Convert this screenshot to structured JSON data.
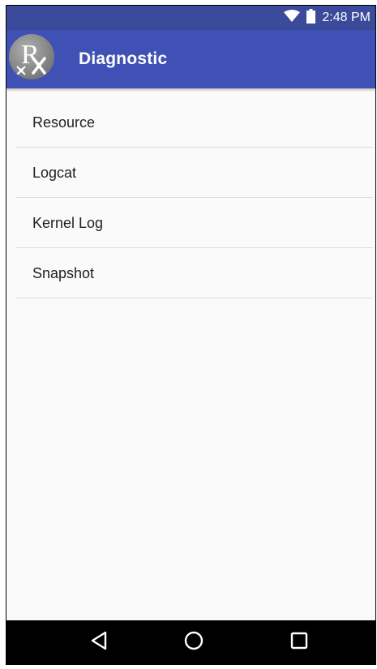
{
  "status_bar": {
    "time": "2:48 PM",
    "icons": [
      "wifi-icon",
      "battery-icon"
    ]
  },
  "app_bar": {
    "title": "Diagnostic",
    "logo_icon": "rx-logo-icon"
  },
  "menu": {
    "items": [
      {
        "label": "Resource"
      },
      {
        "label": "Logcat"
      },
      {
        "label": "Kernel Log"
      },
      {
        "label": "Snapshot"
      }
    ]
  },
  "nav_bar": {
    "buttons": [
      "back-icon",
      "home-icon",
      "recents-icon"
    ]
  },
  "colors": {
    "status_bar": "#3b4a9a",
    "app_bar": "#3f51b5",
    "background": "#fafafa",
    "nav_bar": "#000000",
    "divider": "#dcdcdc"
  }
}
